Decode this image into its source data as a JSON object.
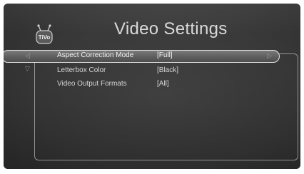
{
  "logo": {
    "text": "TiVo"
  },
  "header": {
    "title": "Video Settings"
  },
  "settings": [
    {
      "label": "Aspect Correction Mode",
      "value": "[Full]",
      "selected": true
    },
    {
      "label": "Letterbox Color",
      "value": "[Black]",
      "selected": false
    },
    {
      "label": "Video Output Formats",
      "value": "[All]",
      "selected": false
    }
  ],
  "icons": {
    "left_arrow": "arrow-left-icon",
    "right_arrow": "arrow-right-icon",
    "down_arrow": "arrow-down-icon"
  },
  "colors": {
    "background": "#3a3a3a",
    "text": "#d6d6d6",
    "highlight_border": "#e6e6e6"
  }
}
